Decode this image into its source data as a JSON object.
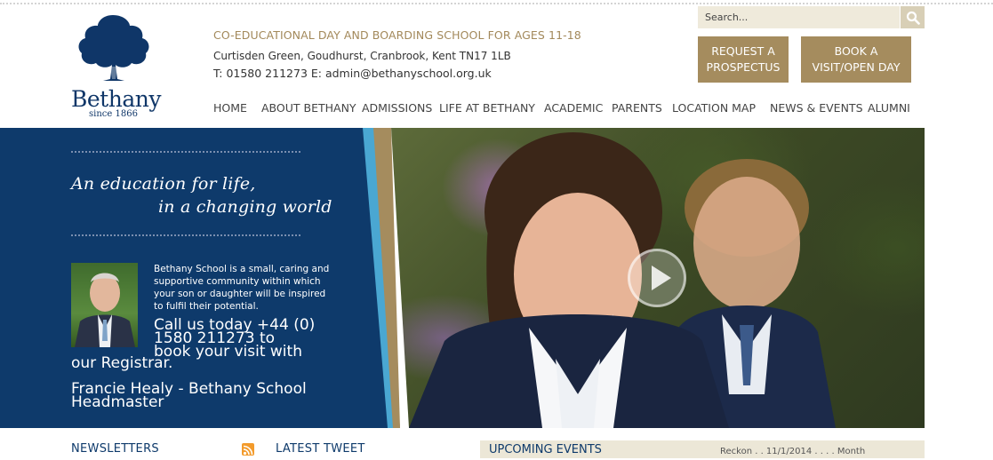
{
  "brand": {
    "name": "Bethany",
    "since": "since 1866"
  },
  "header": {
    "tagline": "CO-EDUCATIONAL DAY AND BOARDING SCHOOL FOR AGES 11-18",
    "address": "Curtisden Green, Goudhurst, Cranbrook, Kent TN17 1LB",
    "contact": "T: 01580 211273 E: admin@bethanyschool.org.uk"
  },
  "search": {
    "placeholder": "Search..."
  },
  "cta": {
    "prospectus": {
      "line1": "REQUEST A",
      "line2": "PROSPECTUS"
    },
    "visit": {
      "line1": "BOOK A",
      "line2": "VISIT/OPEN DAY"
    }
  },
  "nav": {
    "items": [
      {
        "label": "HOME"
      },
      {
        "label": "ABOUT BETHANY"
      },
      {
        "label": "ADMISSIONS"
      },
      {
        "label": "LIFE AT BETHANY"
      },
      {
        "label": "ACADEMIC"
      },
      {
        "label": "PARENTS"
      },
      {
        "label": "LOCATION MAP"
      },
      {
        "label": "NEWS & EVENTS"
      },
      {
        "label": "ALUMNI"
      }
    ]
  },
  "hero": {
    "motto_line1": "An education for life,",
    "motto_line2": "in a changing world",
    "intro": "Bethany School is a small, caring and supportive community within which your son or daughter will be inspired to fulfil their potential.",
    "call_line1": "Call us today +44 (0)",
    "call_line2": "1580 211273 to",
    "call_line3": "book your visit with",
    "call_line4": "our Registrar.",
    "headmaster_line1": "Francie Healy - Bethany School",
    "headmaster_line2": "Headmaster"
  },
  "bottom": {
    "newsletters": "NEWSLETTERS",
    "latest_tweet": "LATEST TWEET",
    "upcoming_events": "UPCOMING EVENTS",
    "events_meta": "Reckon . . 11/1/2014 . . . . Month"
  },
  "icons": {
    "search": "search-icon",
    "rss": "rss-icon",
    "play": "play-icon"
  },
  "colors": {
    "navy": "#0e3a6b",
    "gold": "#a58c5e",
    "cream": "#efeadb",
    "stripe_blue": "#4aa7d2",
    "stripe_gold": "#a58c5e"
  }
}
